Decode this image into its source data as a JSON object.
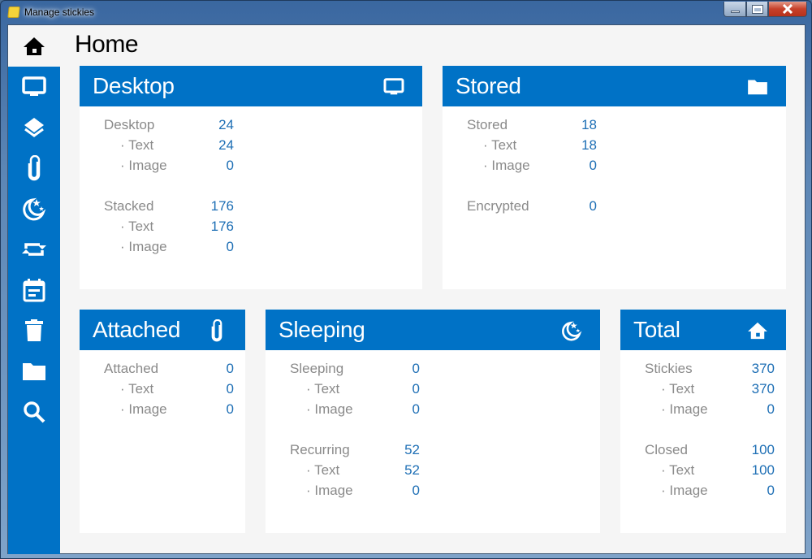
{
  "window": {
    "title": "Manage stickies"
  },
  "page": {
    "title": "Home"
  },
  "colors": {
    "accent": "#0072c6",
    "background": "#f5f5f5",
    "value": "#1e6fb5",
    "label": "#8a8a8a"
  },
  "sidebar": {
    "items": [
      {
        "name": "home",
        "icon": "home-icon"
      },
      {
        "name": "desktop",
        "icon": "monitor-icon"
      },
      {
        "name": "stacked",
        "icon": "layers-icon"
      },
      {
        "name": "attached",
        "icon": "paperclip-icon"
      },
      {
        "name": "sleeping",
        "icon": "moon-stars-icon"
      },
      {
        "name": "recurring",
        "icon": "repeat-icon"
      },
      {
        "name": "calendar",
        "icon": "calendar-icon"
      },
      {
        "name": "closed",
        "icon": "trash-icon"
      },
      {
        "name": "stored",
        "icon": "folder-icon"
      },
      {
        "name": "search",
        "icon": "search-icon"
      }
    ]
  },
  "cards": {
    "desktop": {
      "title": "Desktop",
      "icon": "monitor-icon",
      "groups": [
        {
          "rows": [
            {
              "label": "Desktop",
              "value": "24"
            },
            {
              "label": "· Text",
              "value": "24"
            },
            {
              "label": "· Image",
              "value": "0"
            }
          ]
        },
        {
          "rows": [
            {
              "label": "Stacked",
              "value": "176"
            },
            {
              "label": "· Text",
              "value": "176"
            },
            {
              "label": "· Image",
              "value": "0"
            }
          ]
        }
      ]
    },
    "stored": {
      "title": "Stored",
      "icon": "folder-icon",
      "groups": [
        {
          "rows": [
            {
              "label": "Stored",
              "value": "18"
            },
            {
              "label": "· Text",
              "value": "18"
            },
            {
              "label": "· Image",
              "value": "0"
            }
          ]
        },
        {
          "rows": [
            {
              "label": "Encrypted",
              "value": "0"
            }
          ]
        }
      ]
    },
    "attached": {
      "title": "Attached",
      "icon": "paperclip-icon",
      "groups": [
        {
          "rows": [
            {
              "label": "Attached",
              "value": "0"
            },
            {
              "label": "· Text",
              "value": "0"
            },
            {
              "label": "· Image",
              "value": "0"
            }
          ]
        }
      ]
    },
    "sleeping": {
      "title": "Sleeping",
      "icon": "moon-stars-icon",
      "groups": [
        {
          "rows": [
            {
              "label": "Sleeping",
              "value": "0"
            },
            {
              "label": "· Text",
              "value": "0"
            },
            {
              "label": "· Image",
              "value": "0"
            }
          ]
        },
        {
          "rows": [
            {
              "label": "Recurring",
              "value": "52"
            },
            {
              "label": "· Text",
              "value": "52"
            },
            {
              "label": "· Image",
              "value": "0"
            }
          ]
        }
      ]
    },
    "total": {
      "title": "Total",
      "icon": "home-icon",
      "groups": [
        {
          "rows": [
            {
              "label": "Stickies",
              "value": "370"
            },
            {
              "label": "· Text",
              "value": "370"
            },
            {
              "label": "· Image",
              "value": "0"
            }
          ]
        },
        {
          "rows": [
            {
              "label": "Closed",
              "value": "100"
            },
            {
              "label": "· Text",
              "value": "100"
            },
            {
              "label": "· Image",
              "value": "0"
            }
          ]
        }
      ]
    }
  }
}
